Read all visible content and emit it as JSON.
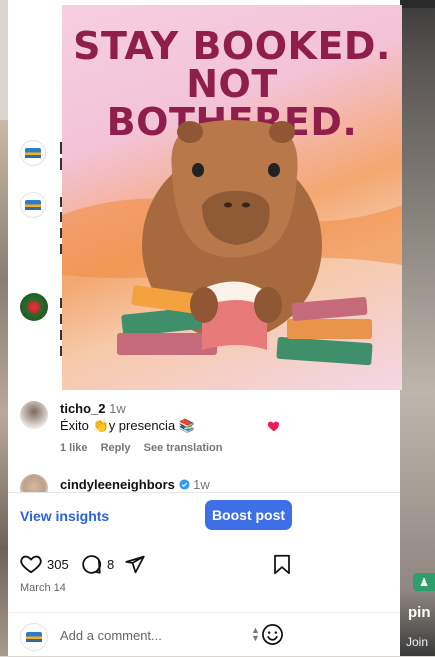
{
  "feature": {
    "headline_line1": "STAY BOOKED.",
    "headline_line2": "NOT BOTHERED."
  },
  "comments": [
    {
      "user": "ticho_2",
      "time": "1w",
      "text": "Éxito 👏y presencia 📚",
      "likes": "1 like",
      "reply": "Reply",
      "translate": "See translation"
    },
    {
      "user": "cindyleeneighbors",
      "time": "1w"
    }
  ],
  "insights": {
    "view_label": "View insights",
    "boost_label": "Boost post"
  },
  "actions": {
    "likes_count": "305",
    "comments_count": "8"
  },
  "post_date": "March 14",
  "add_comment_placeholder": "Add a comment...",
  "background": {
    "pin_label": "pin",
    "join_label": "Join"
  },
  "colors": {
    "accent": "#3f6fe6",
    "link": "#2b63d9",
    "headline": "#8f1e4d",
    "like_red": "#ee1d52"
  },
  "icons": [
    "heart-icon",
    "comment-icon",
    "share-icon",
    "bookmark-icon",
    "emoji-icon",
    "verified-icon"
  ]
}
